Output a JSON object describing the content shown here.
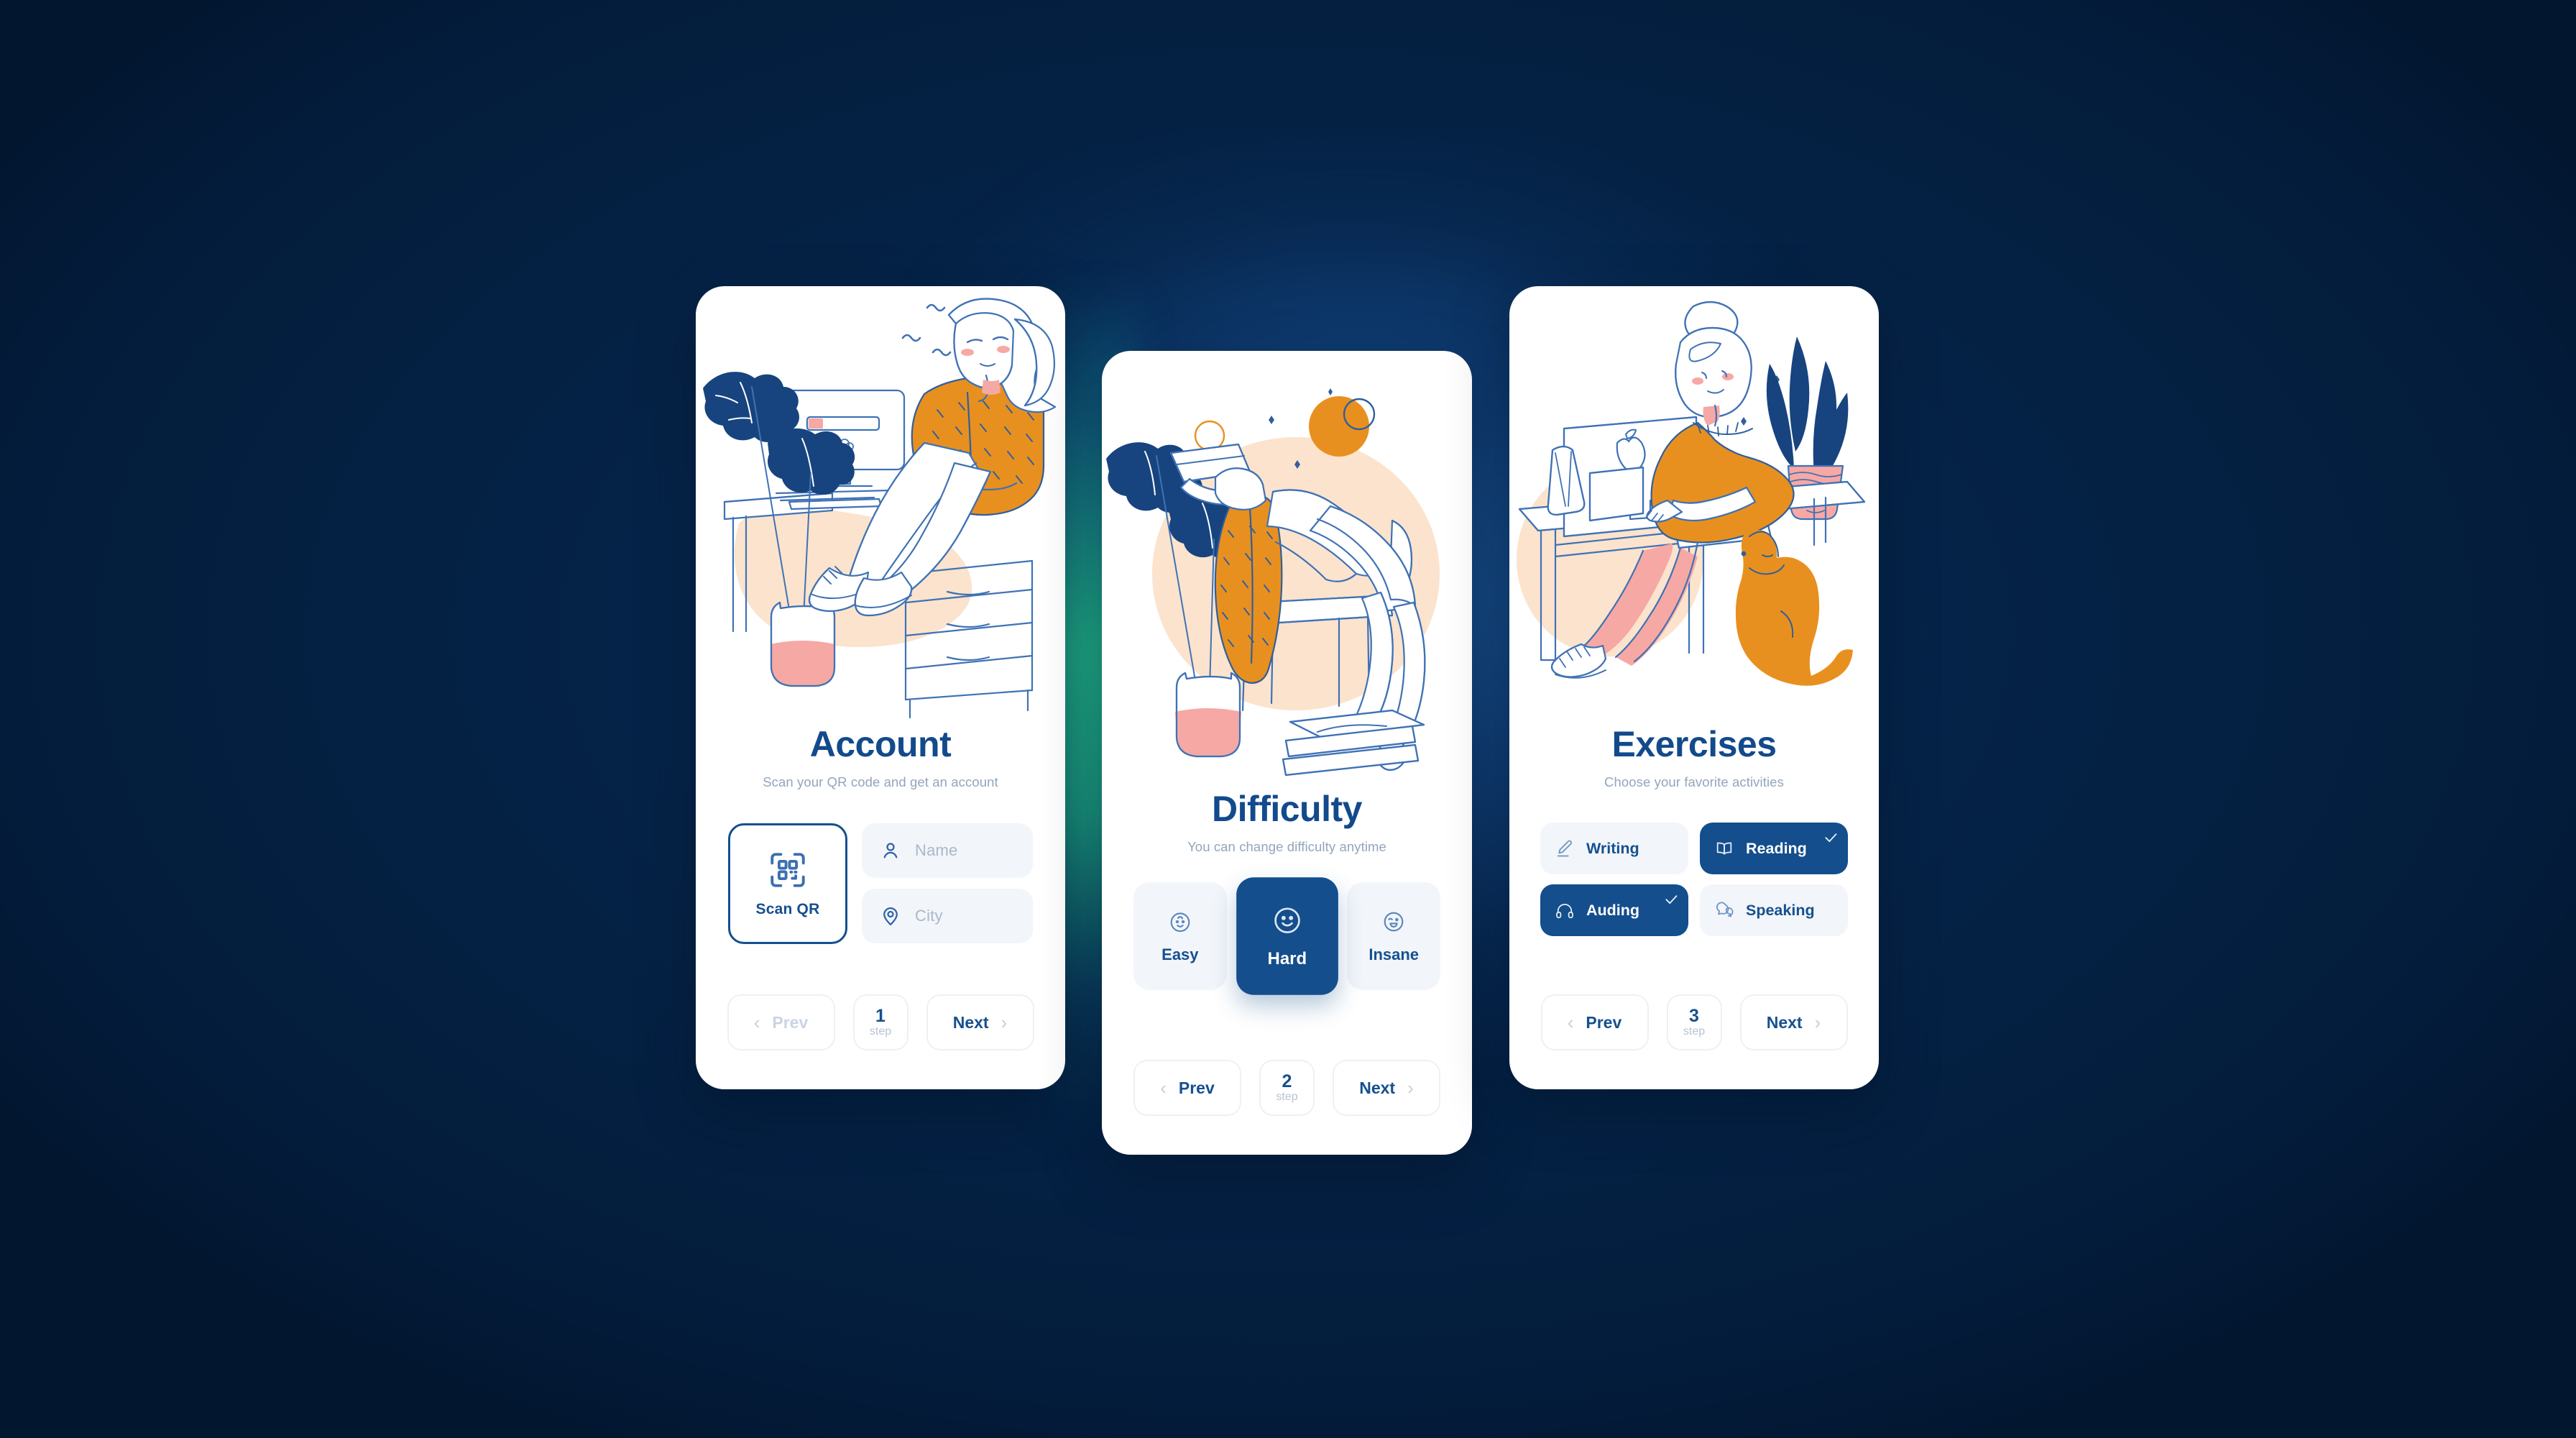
{
  "theme": {
    "background": "#052449",
    "glow_blue": "#1e60a6",
    "glow_teal": "#22be8c",
    "brand_blue": "#144e8c",
    "title_blue": "#124a8c",
    "muted_text": "#93a5bb",
    "field_bg": "#f2f5f9",
    "orange": "#e8901f",
    "peach": "#fbe3cd",
    "pink": "#f6a8a4",
    "navy_ink": "#1b4f8f"
  },
  "cards": [
    {
      "id": "account",
      "title": "Account",
      "subtitle": "Scan your QR code and get an account",
      "illustration_name": "woman-sitting-on-drawers-with-monitor",
      "illustration_label": "10%",
      "scan": {
        "label": "Scan QR",
        "icon": "qr-scan-icon"
      },
      "fields": [
        {
          "name": "name",
          "placeholder": "Name",
          "value": "",
          "icon": "user-icon"
        },
        {
          "name": "city",
          "placeholder": "City",
          "value": "",
          "icon": "location-pin-icon"
        }
      ],
      "nav": {
        "prev_label": "Prev",
        "next_label": "Next",
        "prev_disabled": true,
        "step_number": "1",
        "step_word": "step"
      }
    },
    {
      "id": "difficulty",
      "title": "Difficulty",
      "subtitle": "You can change difficulty anytime",
      "illustration_name": "woman-reclining-reading-book-with-plants",
      "options": [
        {
          "label": "Easy",
          "icon": "baby-face-icon",
          "selected": false
        },
        {
          "label": "Hard",
          "icon": "smiley-face-icon",
          "selected": true
        },
        {
          "label": "Insane",
          "icon": "laughing-face-icon",
          "selected": false
        }
      ],
      "nav": {
        "prev_label": "Prev",
        "next_label": "Next",
        "prev_disabled": false,
        "step_number": "2",
        "step_word": "step"
      }
    },
    {
      "id": "exercises",
      "title": "Exercises",
      "subtitle": "Choose your favorite activities",
      "illustration_name": "woman-at-desk-with-imac-and-dog",
      "activities": [
        {
          "label": "Writing",
          "icon": "pencil-icon",
          "selected": false
        },
        {
          "label": "Reading",
          "icon": "open-book-icon",
          "selected": true
        },
        {
          "label": "Auding",
          "icon": "headphones-icon",
          "selected": true
        },
        {
          "label": "Speaking",
          "icon": "chat-bubbles-icon",
          "selected": false
        }
      ],
      "nav": {
        "prev_label": "Prev",
        "next_label": "Next",
        "prev_disabled": false,
        "step_number": "3",
        "step_word": "step"
      }
    }
  ],
  "glyphs": {
    "chevron_left": "‹",
    "chevron_right": "›"
  }
}
